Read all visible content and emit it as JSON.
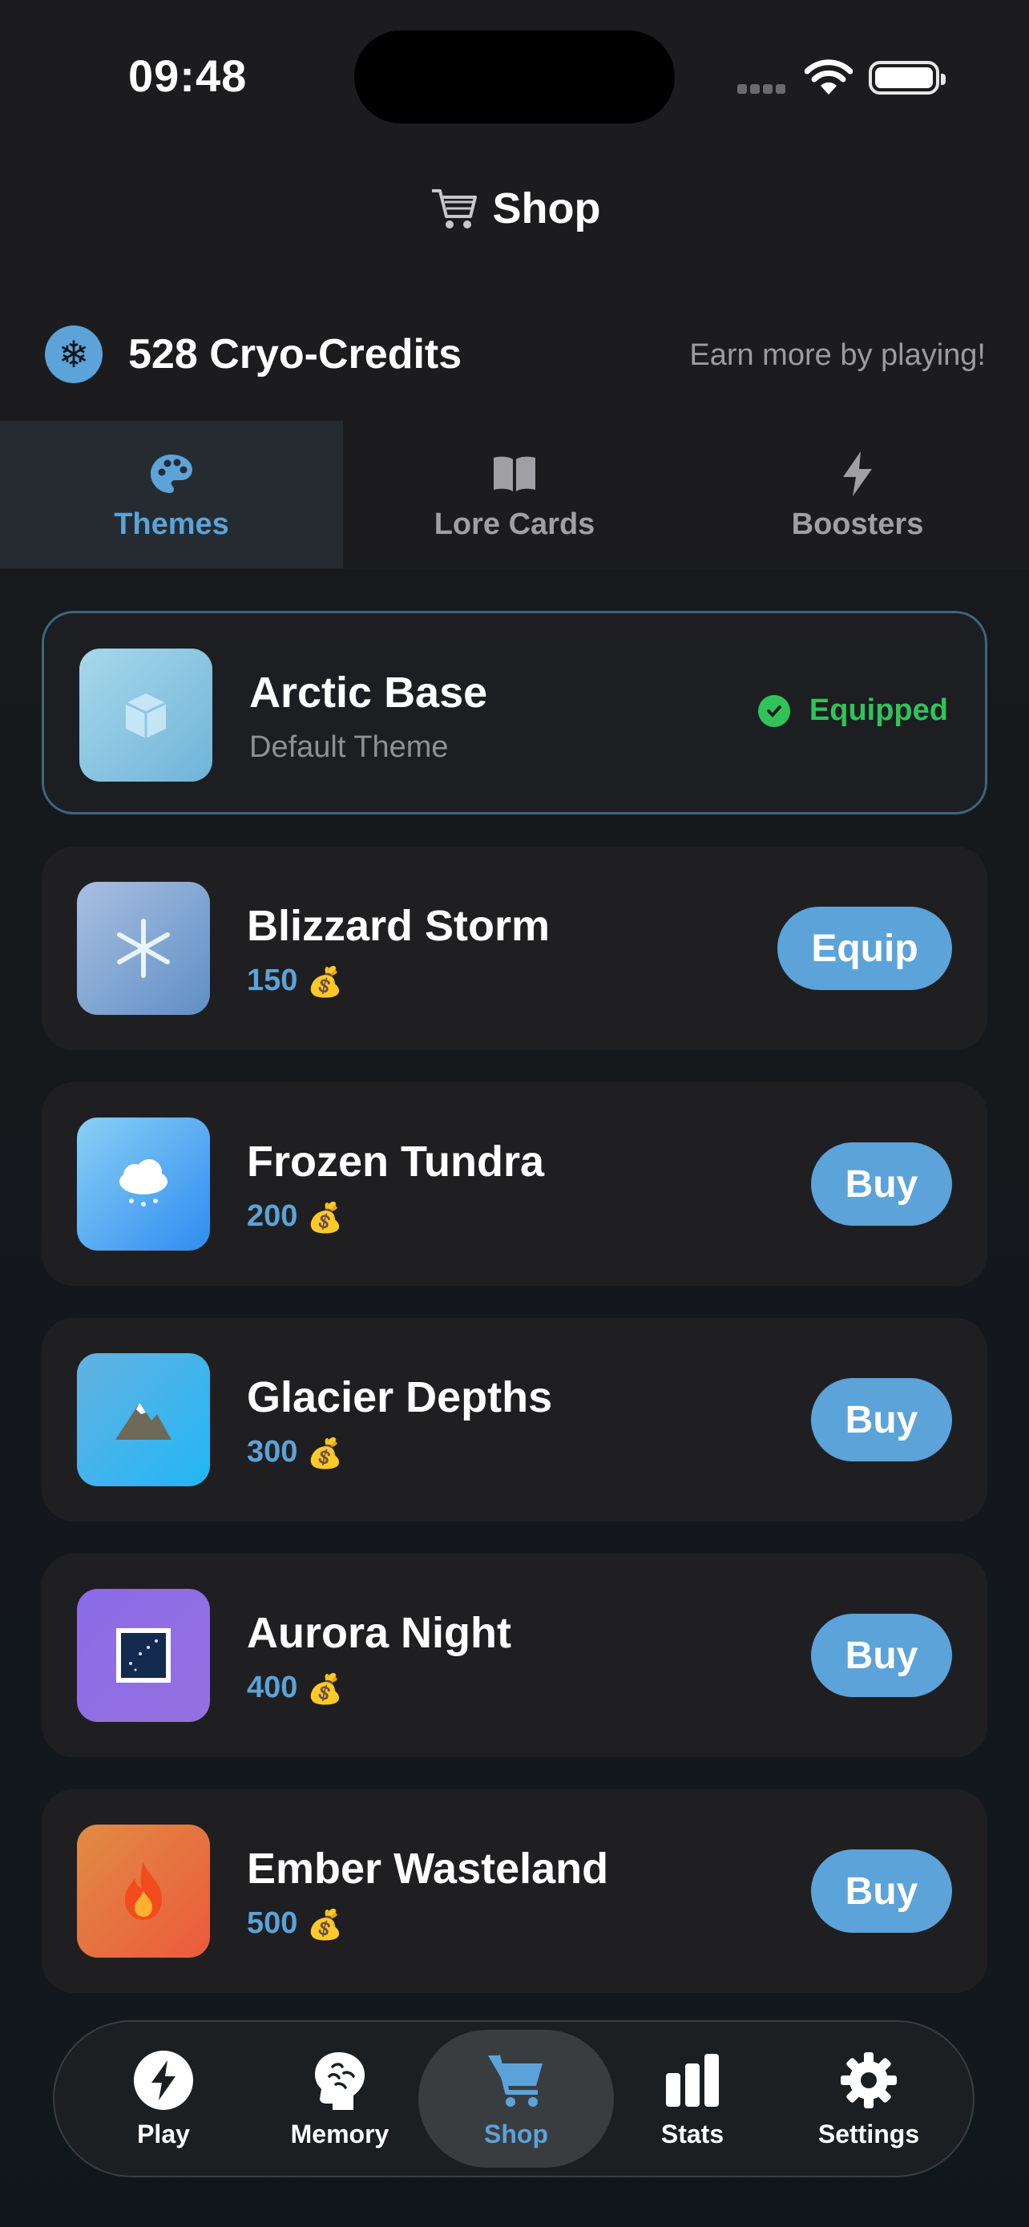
{
  "status_bar": {
    "time": "09:48"
  },
  "header": {
    "title": "Shop",
    "icon": "shopping-cart-icon"
  },
  "credits": {
    "amount_label": "528 Cryo-Credits",
    "hint": "Earn more by playing!",
    "icon": "snowflake-icon"
  },
  "tabs": [
    {
      "label": "Themes",
      "icon": "palette-icon",
      "active": true
    },
    {
      "label": "Lore Cards",
      "icon": "book-icon",
      "active": false
    },
    {
      "label": "Boosters",
      "icon": "lightning-icon",
      "active": false
    }
  ],
  "themes": [
    {
      "name": "Arctic Base",
      "subtitle": "Default Theme",
      "status": "Equipped",
      "thumb": "ice-cube-icon",
      "gradient": [
        "#a7d8ea",
        "#6fb4d8"
      ]
    },
    {
      "name": "Blizzard Storm",
      "price": "150",
      "action": "Equip",
      "thumb": "snowflake-icon",
      "gradient": [
        "#a9bfe0",
        "#5f8fc6"
      ]
    },
    {
      "name": "Frozen Tundra",
      "price": "200",
      "action": "Buy",
      "thumb": "snow-cloud-icon",
      "gradient": [
        "#8ad0f5",
        "#2f8cf0"
      ]
    },
    {
      "name": "Glacier Depths",
      "price": "300",
      "action": "Buy",
      "thumb": "mountain-icon",
      "gradient": [
        "#64b2e0",
        "#22b6f5"
      ]
    },
    {
      "name": "Aurora Night",
      "price": "400",
      "action": "Buy",
      "thumb": "night-sky-icon",
      "gradient": [
        "#8b6be8",
        "#9471e0"
      ]
    },
    {
      "name": "Ember Wasteland",
      "price": "500",
      "action": "Buy",
      "thumb": "fire-icon",
      "gradient": [
        "#e08c44",
        "#ec5a3c"
      ]
    }
  ],
  "bottom_nav": [
    {
      "label": "Play",
      "icon": "bolt-icon"
    },
    {
      "label": "Memory",
      "icon": "brain-icon"
    },
    {
      "label": "Shop",
      "icon": "cart-icon",
      "active": true
    },
    {
      "label": "Stats",
      "icon": "bar-chart-icon"
    },
    {
      "label": "Settings",
      "icon": "gear-icon"
    }
  ],
  "colors": {
    "accent": "#5ba3d9",
    "success": "#30c35a",
    "background": "#1c1c1e"
  }
}
